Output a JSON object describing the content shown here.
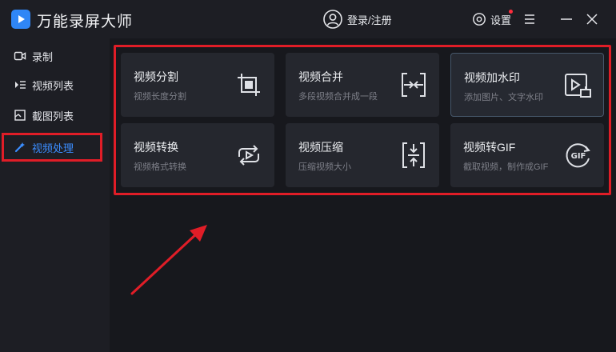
{
  "window": {
    "title": "万能录屏大师",
    "login_label": "登录/注册",
    "settings_label": "设置"
  },
  "sidebar": {
    "items": [
      {
        "label": "录制",
        "icon": "record-icon"
      },
      {
        "label": "视频列表",
        "icon": "video-list-icon"
      },
      {
        "label": "截图列表",
        "icon": "screenshot-list-icon"
      },
      {
        "label": "视频处理",
        "icon": "video-process-icon",
        "active": true
      }
    ]
  },
  "cards": [
    {
      "title": "视频分割",
      "desc": "视频长度分割",
      "icon": "crop-icon"
    },
    {
      "title": "视频合并",
      "desc": "多段视频合并成一段",
      "icon": "merge-icon"
    },
    {
      "title": "视频加水印",
      "desc": "添加图片、文字水印",
      "icon": "watermark-icon"
    },
    {
      "title": "视频转换",
      "desc": "视频格式转换",
      "icon": "convert-icon"
    },
    {
      "title": "视频压缩",
      "desc": "压缩视频大小",
      "icon": "compress-icon"
    },
    {
      "title": "视频转GIF",
      "desc": "截取视频，制作成GIF",
      "icon": "gif-icon",
      "icon_text": "GIF"
    }
  ],
  "colors": {
    "accent": "#3b8dff",
    "highlight": "#e01d27",
    "card_bg": "#25272e"
  }
}
